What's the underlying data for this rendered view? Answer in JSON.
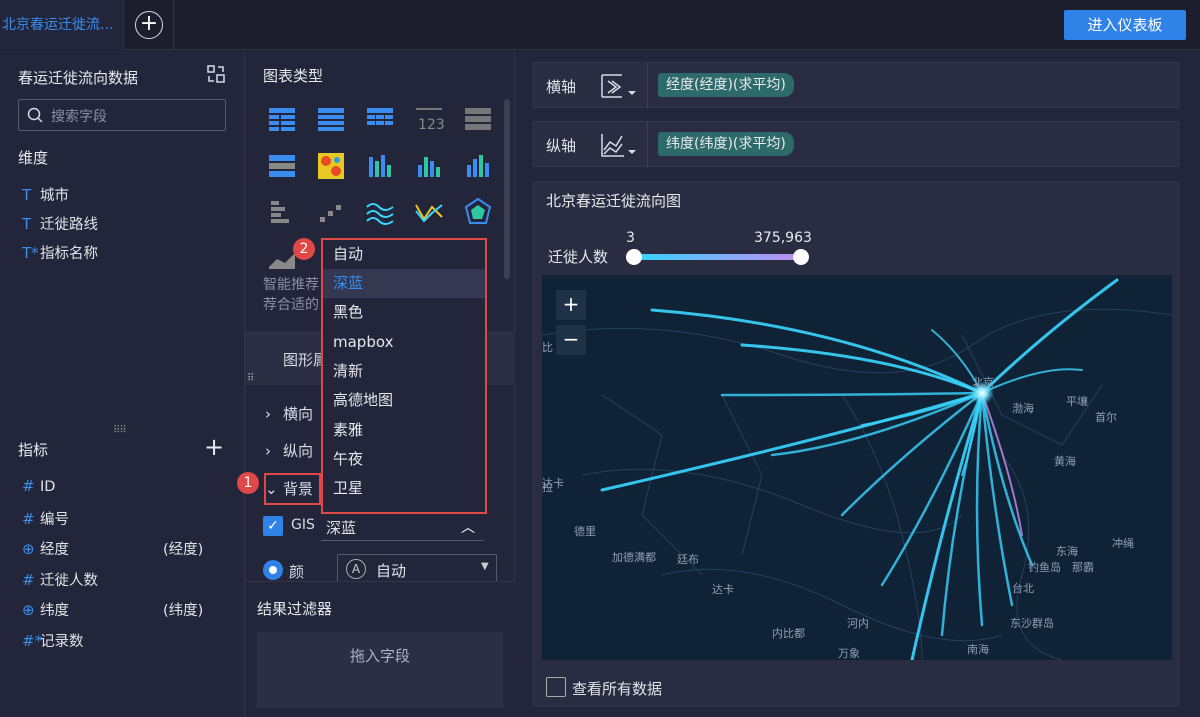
{
  "topbar": {
    "tab_title": "北京春运迁徙流...",
    "enter_dashboard": "进入仪表板"
  },
  "left": {
    "dataset_title": "春运迁徙流向数据",
    "search_placeholder": "搜索字段",
    "dimension_label": "维度",
    "dimensions": [
      {
        "icon": "T",
        "label": "城市"
      },
      {
        "icon": "T",
        "label": "迁徙路线"
      },
      {
        "icon": "T*",
        "label": "指标名称"
      }
    ],
    "metric_label": "指标",
    "metrics": [
      {
        "icon": "#",
        "label": "ID",
        "suffix": ""
      },
      {
        "icon": "#",
        "label": "编号",
        "suffix": ""
      },
      {
        "icon": "globe",
        "label": "经度",
        "suffix": "(经度)"
      },
      {
        "icon": "#",
        "label": "迁徙人数",
        "suffix": ""
      },
      {
        "icon": "globe",
        "label": "纬度",
        "suffix": "(纬度)"
      },
      {
        "icon": "#*",
        "label": "记录数",
        "suffix": ""
      }
    ]
  },
  "mid": {
    "chart_type_title": "图表类型",
    "smart_text_1": "智能推荐",
    "smart_text_2": "荐合适的",
    "style_tab": "图形属",
    "acc_h": "横向",
    "acc_v": "纵向",
    "acc_bg": "背景",
    "gis_label": "GIS",
    "gis_value": "深蓝",
    "color_label": "颜色",
    "color_value": "自动",
    "filter_title": "结果过滤器",
    "filter_drop": "拖入字段"
  },
  "dropdown": {
    "items": [
      "自动",
      "深蓝",
      "黑色",
      "mapbox",
      "清新",
      "高德地图",
      "素雅",
      "午夜",
      "卫星"
    ],
    "highlight_index": 1
  },
  "badges": {
    "one": "1",
    "two": "2"
  },
  "right": {
    "x_axis_label": "横轴",
    "x_axis_field": "经度(经度)(求平均)",
    "y_axis_label": "纵轴",
    "y_axis_field": "纬度(纬度)(求平均)",
    "chart_title": "北京春运迁徙流向图",
    "legend_label": "迁徙人数",
    "legend_min": "3",
    "legend_max": "375,963",
    "view_all": "查看所有数据",
    "map_labels": [
      "北京",
      "渤海",
      "平壤",
      "首尔",
      "黄海",
      "东海",
      "达卡",
      "德里",
      "加德满都",
      "廷布",
      "达卡",
      "内比都",
      "河内",
      "万象",
      "南海",
      "台北",
      "东沙群岛",
      "冲绳",
      "钓鱼岛",
      "那霸",
      "比",
      "拉"
    ]
  },
  "colors": {
    "accent": "#2f82e8",
    "highlight": "#e04848",
    "bg": "#23263a",
    "map_bg": "#0f2236",
    "flow": "#3ad6ff"
  }
}
